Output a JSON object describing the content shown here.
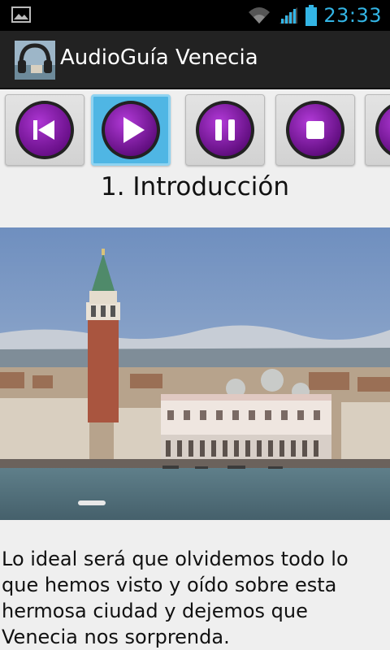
{
  "status_bar": {
    "time": "23:33",
    "icons": [
      "image-notification-icon",
      "wifi-icon",
      "signal-icon",
      "battery-icon"
    ],
    "accent": "#33b5e5"
  },
  "action_bar": {
    "title": "AudioGuía Venecia",
    "icon": "headphones-app-icon"
  },
  "controls": {
    "buttons": [
      {
        "name": "previous",
        "icon": "skip-previous-icon"
      },
      {
        "name": "play",
        "icon": "play-icon",
        "active": true
      },
      {
        "name": "pause",
        "icon": "pause-icon"
      },
      {
        "name": "stop",
        "icon": "stop-icon"
      },
      {
        "name": "next",
        "icon": "skip-next-icon"
      }
    ],
    "button_color": "#7a0f9a"
  },
  "track": {
    "title": "1. Introducción"
  },
  "image": {
    "subject": "venice-panorama-image"
  },
  "description": "Lo ideal será que olvidemos todo lo que hemos visto y oído sobre esta hermosa ciudad y dejemos que Venecia nos sorprenda."
}
